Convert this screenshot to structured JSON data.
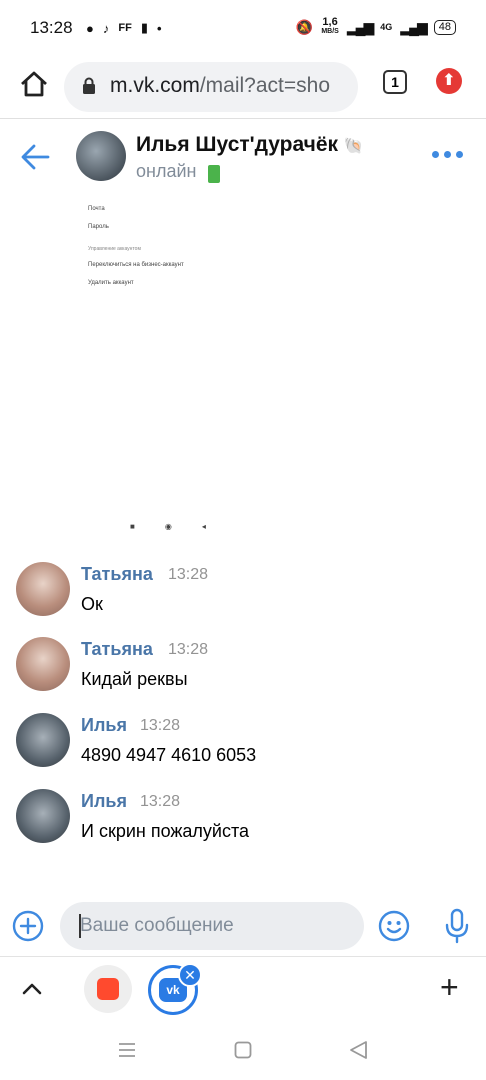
{
  "status_bar": {
    "time": "13:28",
    "net_speed_value": "1,6",
    "net_speed_unit": "MB/S",
    "network": "4G",
    "battery": "48"
  },
  "browser": {
    "url_host": "m.vk.com",
    "url_path": "/mail?act=sho",
    "tab_count": "1"
  },
  "chat": {
    "title": "Илья Шуст'дурачёк",
    "title_emoji": "🐚",
    "status": "онлайн"
  },
  "attachment": {
    "lines": [
      "Почта",
      "Пароль",
      "Управление аккаунтом",
      "Переключиться на бизнес-аккаунт",
      "Удалить аккаунт"
    ]
  },
  "messages": [
    {
      "author": "Татьяна",
      "time": "13:28",
      "text": "Ок"
    },
    {
      "author": "Татьяна",
      "time": "13:28",
      "text": "Кидай реквы"
    },
    {
      "author": "Илья",
      "time": "13:28",
      "text": "4890 4947 4610 6053"
    },
    {
      "author": "Илья",
      "time": "13:28",
      "text": "И скрин пожалуйста"
    }
  ],
  "composer": {
    "placeholder": "Ваше сообщение"
  },
  "colors": {
    "accent": "#4a76a8",
    "link_blue": "#3f8ae0",
    "online_green": "#4bb34b"
  }
}
